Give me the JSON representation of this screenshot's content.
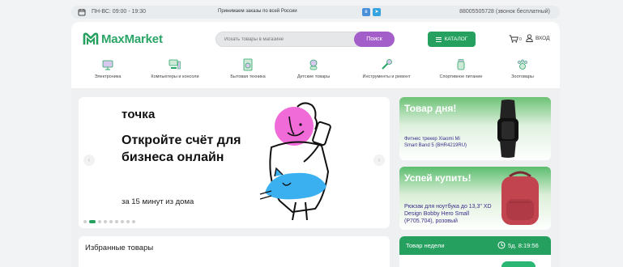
{
  "topbar": {
    "hours": "ПН-ВС: 09:00 - 19:30",
    "delivery": "Принимаем заказы по всей России",
    "phone": "88005505728 (звонок бесплатный)",
    "social": [
      "vk-icon",
      "telegram-icon"
    ]
  },
  "header": {
    "logo_text": "MaxMarket",
    "search_placeholder": "Искать товары в магазине",
    "search_button": "Поиск",
    "catalog_button": "КАТАЛОГ",
    "cart_count": "0",
    "login": "ВХОД"
  },
  "categories": [
    {
      "label": "Электроника",
      "icon": "electronics-icon"
    },
    {
      "label": "Компьютеры и консоли",
      "icon": "computer-icon"
    },
    {
      "label": "Бытовая техника",
      "icon": "washing-machine-icon"
    },
    {
      "label": "Детские товары",
      "icon": "kids-icon"
    },
    {
      "label": "Инструменты и ремонт",
      "icon": "tools-icon"
    },
    {
      "label": "Спортивное питание",
      "icon": "sport-nutrition-icon"
    },
    {
      "label": "Зоотовары",
      "icon": "pet-icon"
    }
  ],
  "banner": {
    "brand": "точка",
    "headline": "Откройте счёт для бизнеса онлайн",
    "subtext": "за 15 минут из дома",
    "slides": 9,
    "active_slide": 2
  },
  "promo_day": {
    "title": "Товар дня!",
    "product": "Фитнес трекер Xiaomi Mi Smart Band 5 (BHR4219RU)"
  },
  "promo_hurry": {
    "title": "Успей купить!",
    "product": "Рюкзак для ноутбука до 13,3\" XD Design Bobby Hero Small (P705.704), розовый"
  },
  "featured": {
    "title": "Избранные товары"
  },
  "week": {
    "title": "Товар недели",
    "timer": "5д. 8:19:56"
  },
  "colors": {
    "brand_green": "#25a05f",
    "accent_purple": "#a35ec9",
    "promo_text": "#3c2d8a"
  }
}
